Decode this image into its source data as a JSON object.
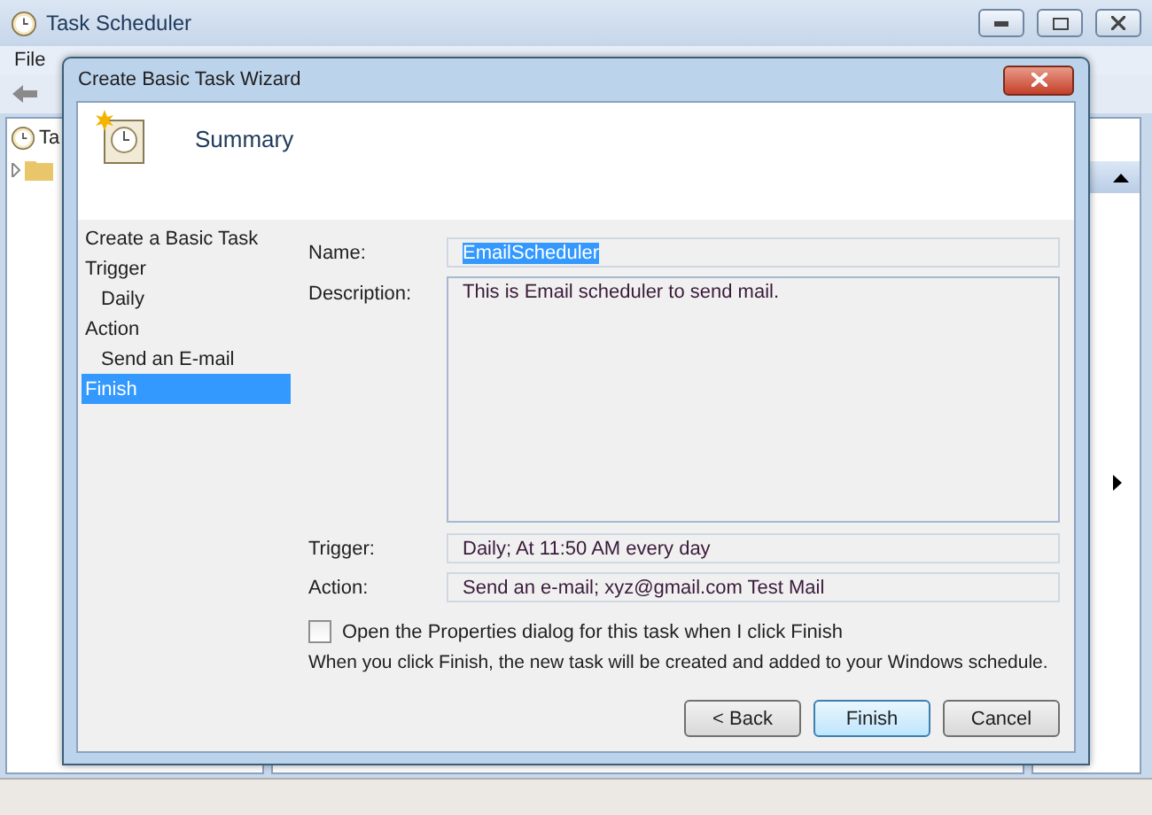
{
  "window": {
    "title": "Task Scheduler"
  },
  "menu": [
    "File"
  ],
  "tree": {
    "label": "Ta",
    "expanded": false
  },
  "dialog": {
    "title": "Create Basic Task Wizard",
    "heading": "Summary",
    "steps": [
      {
        "label": "Create a Basic Task",
        "selected": false
      },
      {
        "label": "Trigger",
        "selected": false,
        "children": [
          {
            "label": "Daily",
            "selected": false
          }
        ]
      },
      {
        "label": "Action",
        "selected": false,
        "children": [
          {
            "label": "Send an E-mail",
            "selected": false
          }
        ]
      },
      {
        "label": "Finish",
        "selected": true
      }
    ],
    "fields": [
      {
        "kind": "line",
        "label": "Name:",
        "value": "EmailScheduler",
        "highlighted": true
      },
      {
        "kind": "area",
        "label": "Description:",
        "value": "This is Email scheduler to send mail.",
        "highlighted": false
      },
      {
        "kind": "line",
        "label": "Trigger:",
        "value": "Daily; At 11:50 AM every day",
        "highlighted": false
      },
      {
        "kind": "line",
        "label": "Action:",
        "value": "Send an e-mail; xyz@gmail.com Test Mail",
        "highlighted": false
      }
    ],
    "checkbox": {
      "label": "Open the Properties dialog for this task when I click Finish",
      "checked": false
    },
    "note": "When you click Finish, the new task will be created and added to your Windows schedule.",
    "buttons": [
      {
        "label": "< Back",
        "default": false
      },
      {
        "label": "Finish",
        "default": true
      },
      {
        "label": "Cancel",
        "default": false
      }
    ]
  }
}
